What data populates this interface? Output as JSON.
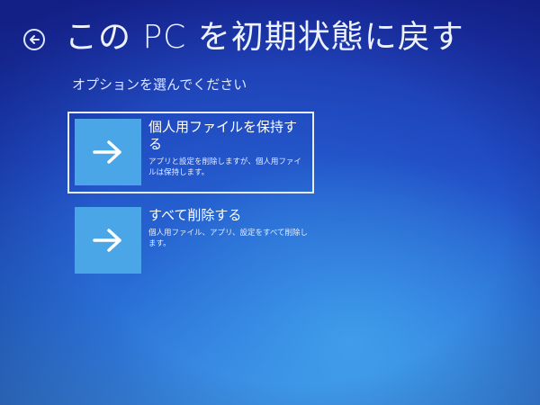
{
  "header": {
    "title": "この PC を初期状態に戻す",
    "back_icon": "back-arrow-circle-icon"
  },
  "subtitle": "オプションを選んでください",
  "options": [
    {
      "title": "個人用ファイルを保持する",
      "description": "アプリと設定を削除しますが、個人用ファイルは保持します。",
      "icon": "arrow-right-icon",
      "selected": true
    },
    {
      "title": "すべて削除する",
      "description": "個人用ファイル、アプリ、設定をすべて削除します。",
      "icon": "arrow-right-icon",
      "selected": false
    }
  ],
  "colors": {
    "tile": "#4aa6e6",
    "background_top": "#1a2aa0",
    "background_bottom": "#3d8fe4",
    "text": "#ffffff"
  }
}
